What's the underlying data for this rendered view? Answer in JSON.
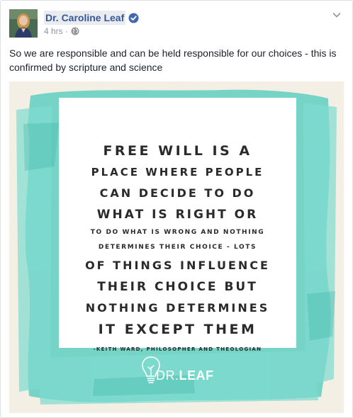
{
  "post": {
    "author": "Dr. Caroline Leaf",
    "timestamp": "4 hrs",
    "separator": "·",
    "privacy_icon": "globe-icon",
    "text": "So we are responsible and can be held responsible for our choices - this is confirmed by scripture and science"
  },
  "image": {
    "quote_lines": [
      "FREE WILL IS A",
      "PLACE WHERE PEOPLE",
      "CAN DECIDE TO DO",
      "WHAT IS RIGHT OR",
      "TO DO WHAT IS WRONG AND NOTHING",
      "DETERMINES THEIR CHOICE - LOTS",
      "OF THINGS INFLUENCE",
      "THEIR CHOICE BUT",
      "NOTHING DETERMINES",
      "IT EXCEPT THEM"
    ],
    "attribution": "-KEITH WARD, PHILOSOPHER AND THEOLOGIAN",
    "logo_light": "DR.",
    "logo_bold": "LEAF",
    "logo_icon": "lightbulb-icon"
  },
  "colors": {
    "link_blue": "#365899",
    "verified_blue": "#4267b2",
    "meta_gray": "#90949c",
    "watercolor_teal": "#5fcfc2",
    "paper": "#f4efe4"
  }
}
